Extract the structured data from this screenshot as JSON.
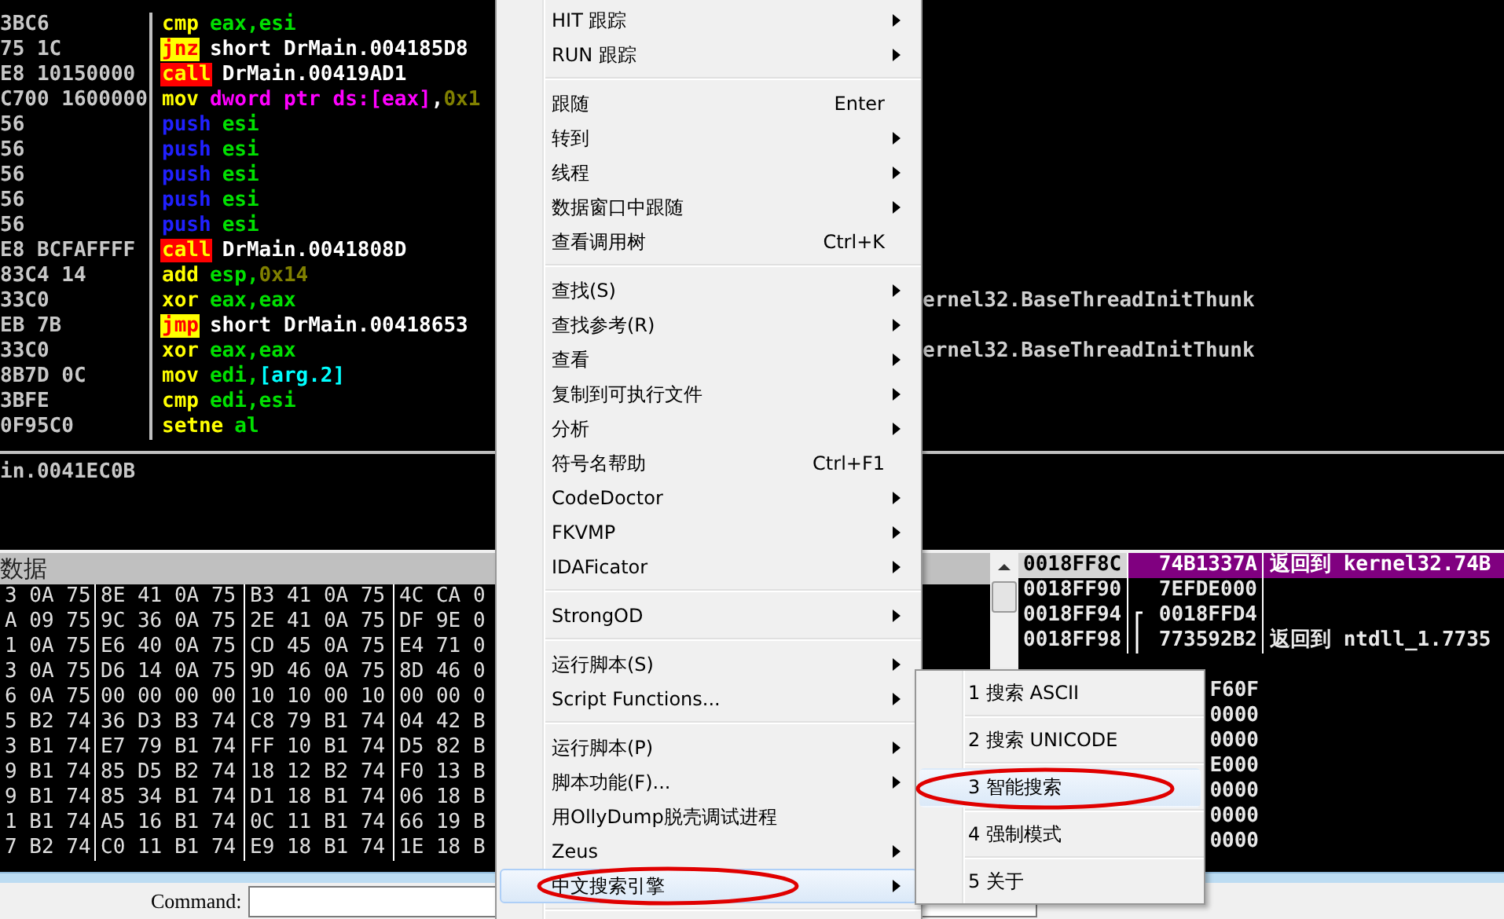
{
  "disassembly": {
    "rows": [
      {
        "bytes": "3BC6",
        "mnemonic": "cmp",
        "kind": "plain",
        "operands": [
          {
            "text": "eax,esi",
            "kind": "reg"
          }
        ]
      },
      {
        "bytes": "75 1C",
        "mnemonic": "jnz",
        "kind": "jump",
        "operands": [
          {
            "text": "short DrMain.004185D8",
            "kind": "label"
          }
        ]
      },
      {
        "bytes": "E8 10150000",
        "mnemonic": "call",
        "kind": "call",
        "operands": [
          {
            "text": "DrMain.00419AD1",
            "kind": "label"
          }
        ]
      },
      {
        "bytes": "C700 1600000",
        "mnemonic": "mov",
        "kind": "plain",
        "operands": [
          {
            "text": "dword ptr ds:[eax]",
            "kind": "mem"
          },
          {
            "text": ",",
            "kind": "label"
          },
          {
            "text": "0x1",
            "kind": "const"
          }
        ]
      },
      {
        "bytes": "56",
        "mnemonic": "push",
        "kind": "push",
        "operands": [
          {
            "text": "esi",
            "kind": "reg"
          }
        ]
      },
      {
        "bytes": "56",
        "mnemonic": "push",
        "kind": "push",
        "operands": [
          {
            "text": "esi",
            "kind": "reg"
          }
        ]
      },
      {
        "bytes": "56",
        "mnemonic": "push",
        "kind": "push",
        "operands": [
          {
            "text": "esi",
            "kind": "reg"
          }
        ]
      },
      {
        "bytes": "56",
        "mnemonic": "push",
        "kind": "push",
        "operands": [
          {
            "text": "esi",
            "kind": "reg"
          }
        ]
      },
      {
        "bytes": "56",
        "mnemonic": "push",
        "kind": "push",
        "operands": [
          {
            "text": "esi",
            "kind": "reg"
          }
        ]
      },
      {
        "bytes": "E8 BCFAFFFF",
        "mnemonic": "call",
        "kind": "call",
        "operands": [
          {
            "text": "DrMain.0041808D",
            "kind": "label"
          }
        ]
      },
      {
        "bytes": "83C4 14",
        "mnemonic": "add",
        "kind": "plain",
        "operands": [
          {
            "text": "esp,",
            "kind": "reg"
          },
          {
            "text": "0x14",
            "kind": "const"
          }
        ]
      },
      {
        "bytes": "33C0",
        "mnemonic": "xor",
        "kind": "plain",
        "operands": [
          {
            "text": "eax,eax",
            "kind": "reg"
          }
        ],
        "comment": "ernel32.BaseThreadInitThunk"
      },
      {
        "bytes": "EB 7B",
        "mnemonic": "jmp",
        "kind": "jump",
        "operands": [
          {
            "text": "short DrMain.00418653",
            "kind": "label"
          }
        ]
      },
      {
        "bytes": "33C0",
        "mnemonic": "xor",
        "kind": "plain",
        "operands": [
          {
            "text": "eax,eax",
            "kind": "reg"
          }
        ],
        "comment": "ernel32.BaseThreadInitThunk"
      },
      {
        "bytes": "8B7D 0C",
        "mnemonic": "mov",
        "kind": "plain",
        "operands": [
          {
            "text": "edi,",
            "kind": "reg"
          },
          {
            "text": "[arg.2]",
            "kind": "arg"
          }
        ]
      },
      {
        "bytes": "3BFE",
        "mnemonic": "cmp",
        "kind": "plain",
        "operands": [
          {
            "text": "edi,esi",
            "kind": "reg"
          }
        ]
      },
      {
        "bytes": "0F95C0",
        "mnemonic": "setne",
        "kind": "plain",
        "operands": [
          {
            "text": "al",
            "kind": "reg"
          }
        ]
      }
    ]
  },
  "info": "in.0041EC0B",
  "dump": {
    "title": "数据",
    "rows": [
      [
        "3 0A 75",
        "8E 41 0A 75",
        "B3 41 0A 75",
        "4C CA 0"
      ],
      [
        "A 09 75",
        "9C 36 0A 75",
        "2E 41 0A 75",
        "DF 9E 0"
      ],
      [
        "1 0A 75",
        "E6 40 0A 75",
        "CD 45 0A 75",
        "E4 71 0"
      ],
      [
        "3 0A 75",
        "D6 14 0A 75",
        "9D 46 0A 75",
        "8D 46 0"
      ],
      [
        "6 0A 75",
        "00 00 00 00",
        "10 10 00 10",
        "00 00 0"
      ],
      [
        "5 B2 74",
        "36 D3 B3 74",
        "C8 79 B1 74",
        "04 42 B"
      ],
      [
        "3 B1 74",
        "E7 79 B1 74",
        "FF 10 B1 74",
        "D5 82 B"
      ],
      [
        "9 B1 74",
        "85 D5 B2 74",
        "18 12 B2 74",
        "F0 13 B"
      ],
      [
        "9 B1 74",
        "85 34 B1 74",
        "D1 18 B1 74",
        "06 18 B"
      ],
      [
        "1 B1 74",
        "A5 16 B1 74",
        "0C 11 B1 74",
        "66 19 B"
      ],
      [
        "7 B2 74",
        "C0 11 B1 74",
        "E9 18 B1 74",
        "1E 18 B"
      ]
    ]
  },
  "stack": {
    "rows": [
      {
        "address": "0018FF8C",
        "value": "74B1337A",
        "comment": "返回到 kernel32.74B",
        "selected": true,
        "frame_start": false,
        "frame_continues": false
      },
      {
        "address": "0018FF90",
        "value": "7EFDE000",
        "selected": false,
        "frame_start": false,
        "frame_continues": false
      },
      {
        "address": "0018FF94",
        "value": "0018FFD4",
        "selected": false,
        "frame_start": true,
        "frame_continues": false
      },
      {
        "address": "0018FF98",
        "value": "773592B2",
        "comment": "返回到 ntdll_1.7735",
        "selected": false,
        "frame_start": false,
        "frame_continues": true
      }
    ],
    "covered_values": [
      "F60F",
      "0000",
      "0000",
      "E000",
      "0000",
      "0000",
      "0000"
    ]
  },
  "command": {
    "label": "Command:"
  },
  "context_menu": {
    "items": [
      {
        "kind": "item",
        "label": "HIT 跟踪",
        "submenu": true,
        "selected": false,
        "circled": false
      },
      {
        "kind": "item",
        "label": "RUN 跟踪",
        "submenu": true,
        "selected": false,
        "circled": false
      },
      {
        "kind": "separator"
      },
      {
        "kind": "item",
        "label": "跟随",
        "shortcut": "Enter",
        "submenu": false,
        "selected": false,
        "circled": false
      },
      {
        "kind": "item",
        "label": "转到",
        "submenu": true,
        "selected": false,
        "circled": false
      },
      {
        "kind": "item",
        "label": "线程",
        "submenu": true,
        "selected": false,
        "circled": false
      },
      {
        "kind": "item",
        "label": "数据窗口中跟随",
        "submenu": true,
        "selected": false,
        "circled": false
      },
      {
        "kind": "item",
        "label": "查看调用树",
        "shortcut": "Ctrl+K",
        "submenu": false,
        "selected": false,
        "circled": false
      },
      {
        "kind": "separator"
      },
      {
        "kind": "item",
        "label": "查找(S)",
        "submenu": true,
        "selected": false,
        "circled": false
      },
      {
        "kind": "item",
        "label": "查找参考(R)",
        "submenu": true,
        "selected": false,
        "circled": false
      },
      {
        "kind": "item",
        "label": "查看",
        "submenu": true,
        "selected": false,
        "circled": false
      },
      {
        "kind": "item",
        "label": "复制到可执行文件",
        "submenu": true,
        "selected": false,
        "circled": false
      },
      {
        "kind": "item",
        "label": "分析",
        "submenu": true,
        "selected": false,
        "circled": false
      },
      {
        "kind": "item",
        "label": "符号名帮助",
        "shortcut": "Ctrl+F1",
        "submenu": false,
        "selected": false,
        "circled": false
      },
      {
        "kind": "item",
        "label": "CodeDoctor",
        "submenu": true,
        "selected": false,
        "circled": false
      },
      {
        "kind": "item",
        "label": "FKVMP",
        "submenu": true,
        "selected": false,
        "circled": false
      },
      {
        "kind": "item",
        "label": "IDAFicator",
        "submenu": true,
        "selected": false,
        "circled": false
      },
      {
        "kind": "separator"
      },
      {
        "kind": "item",
        "label": "StrongOD",
        "submenu": true,
        "selected": false,
        "circled": false
      },
      {
        "kind": "separator"
      },
      {
        "kind": "item",
        "label": "运行脚本(S)",
        "submenu": true,
        "selected": false,
        "circled": false
      },
      {
        "kind": "item",
        "label": "Script Functions...",
        "submenu": true,
        "selected": false,
        "circled": false
      },
      {
        "kind": "separator"
      },
      {
        "kind": "item",
        "label": "运行脚本(P)",
        "submenu": true,
        "selected": false,
        "circled": false
      },
      {
        "kind": "item",
        "label": "脚本功能(F)...",
        "submenu": true,
        "selected": false,
        "circled": false
      },
      {
        "kind": "item",
        "label": "用OllyDump脱壳调试进程",
        "submenu": false,
        "selected": false,
        "circled": false
      },
      {
        "kind": "item",
        "label": "Zeus",
        "submenu": true,
        "selected": false,
        "circled": false
      },
      {
        "kind": "item",
        "label": "中文搜索引擎",
        "submenu": true,
        "selected": true,
        "circled": true
      },
      {
        "kind": "separator"
      }
    ]
  },
  "submenu": {
    "items": [
      {
        "label": "1 搜索 ASCII",
        "selected": false,
        "circled": false
      },
      {
        "label": "2 搜索 UNICODE",
        "selected": false,
        "circled": false
      },
      {
        "label": "3 智能搜索",
        "selected": true,
        "circled": true
      },
      {
        "label": "4 强制模式",
        "selected": false,
        "circled": false
      },
      {
        "label": "5 关于",
        "selected": false,
        "circled": false
      }
    ]
  }
}
